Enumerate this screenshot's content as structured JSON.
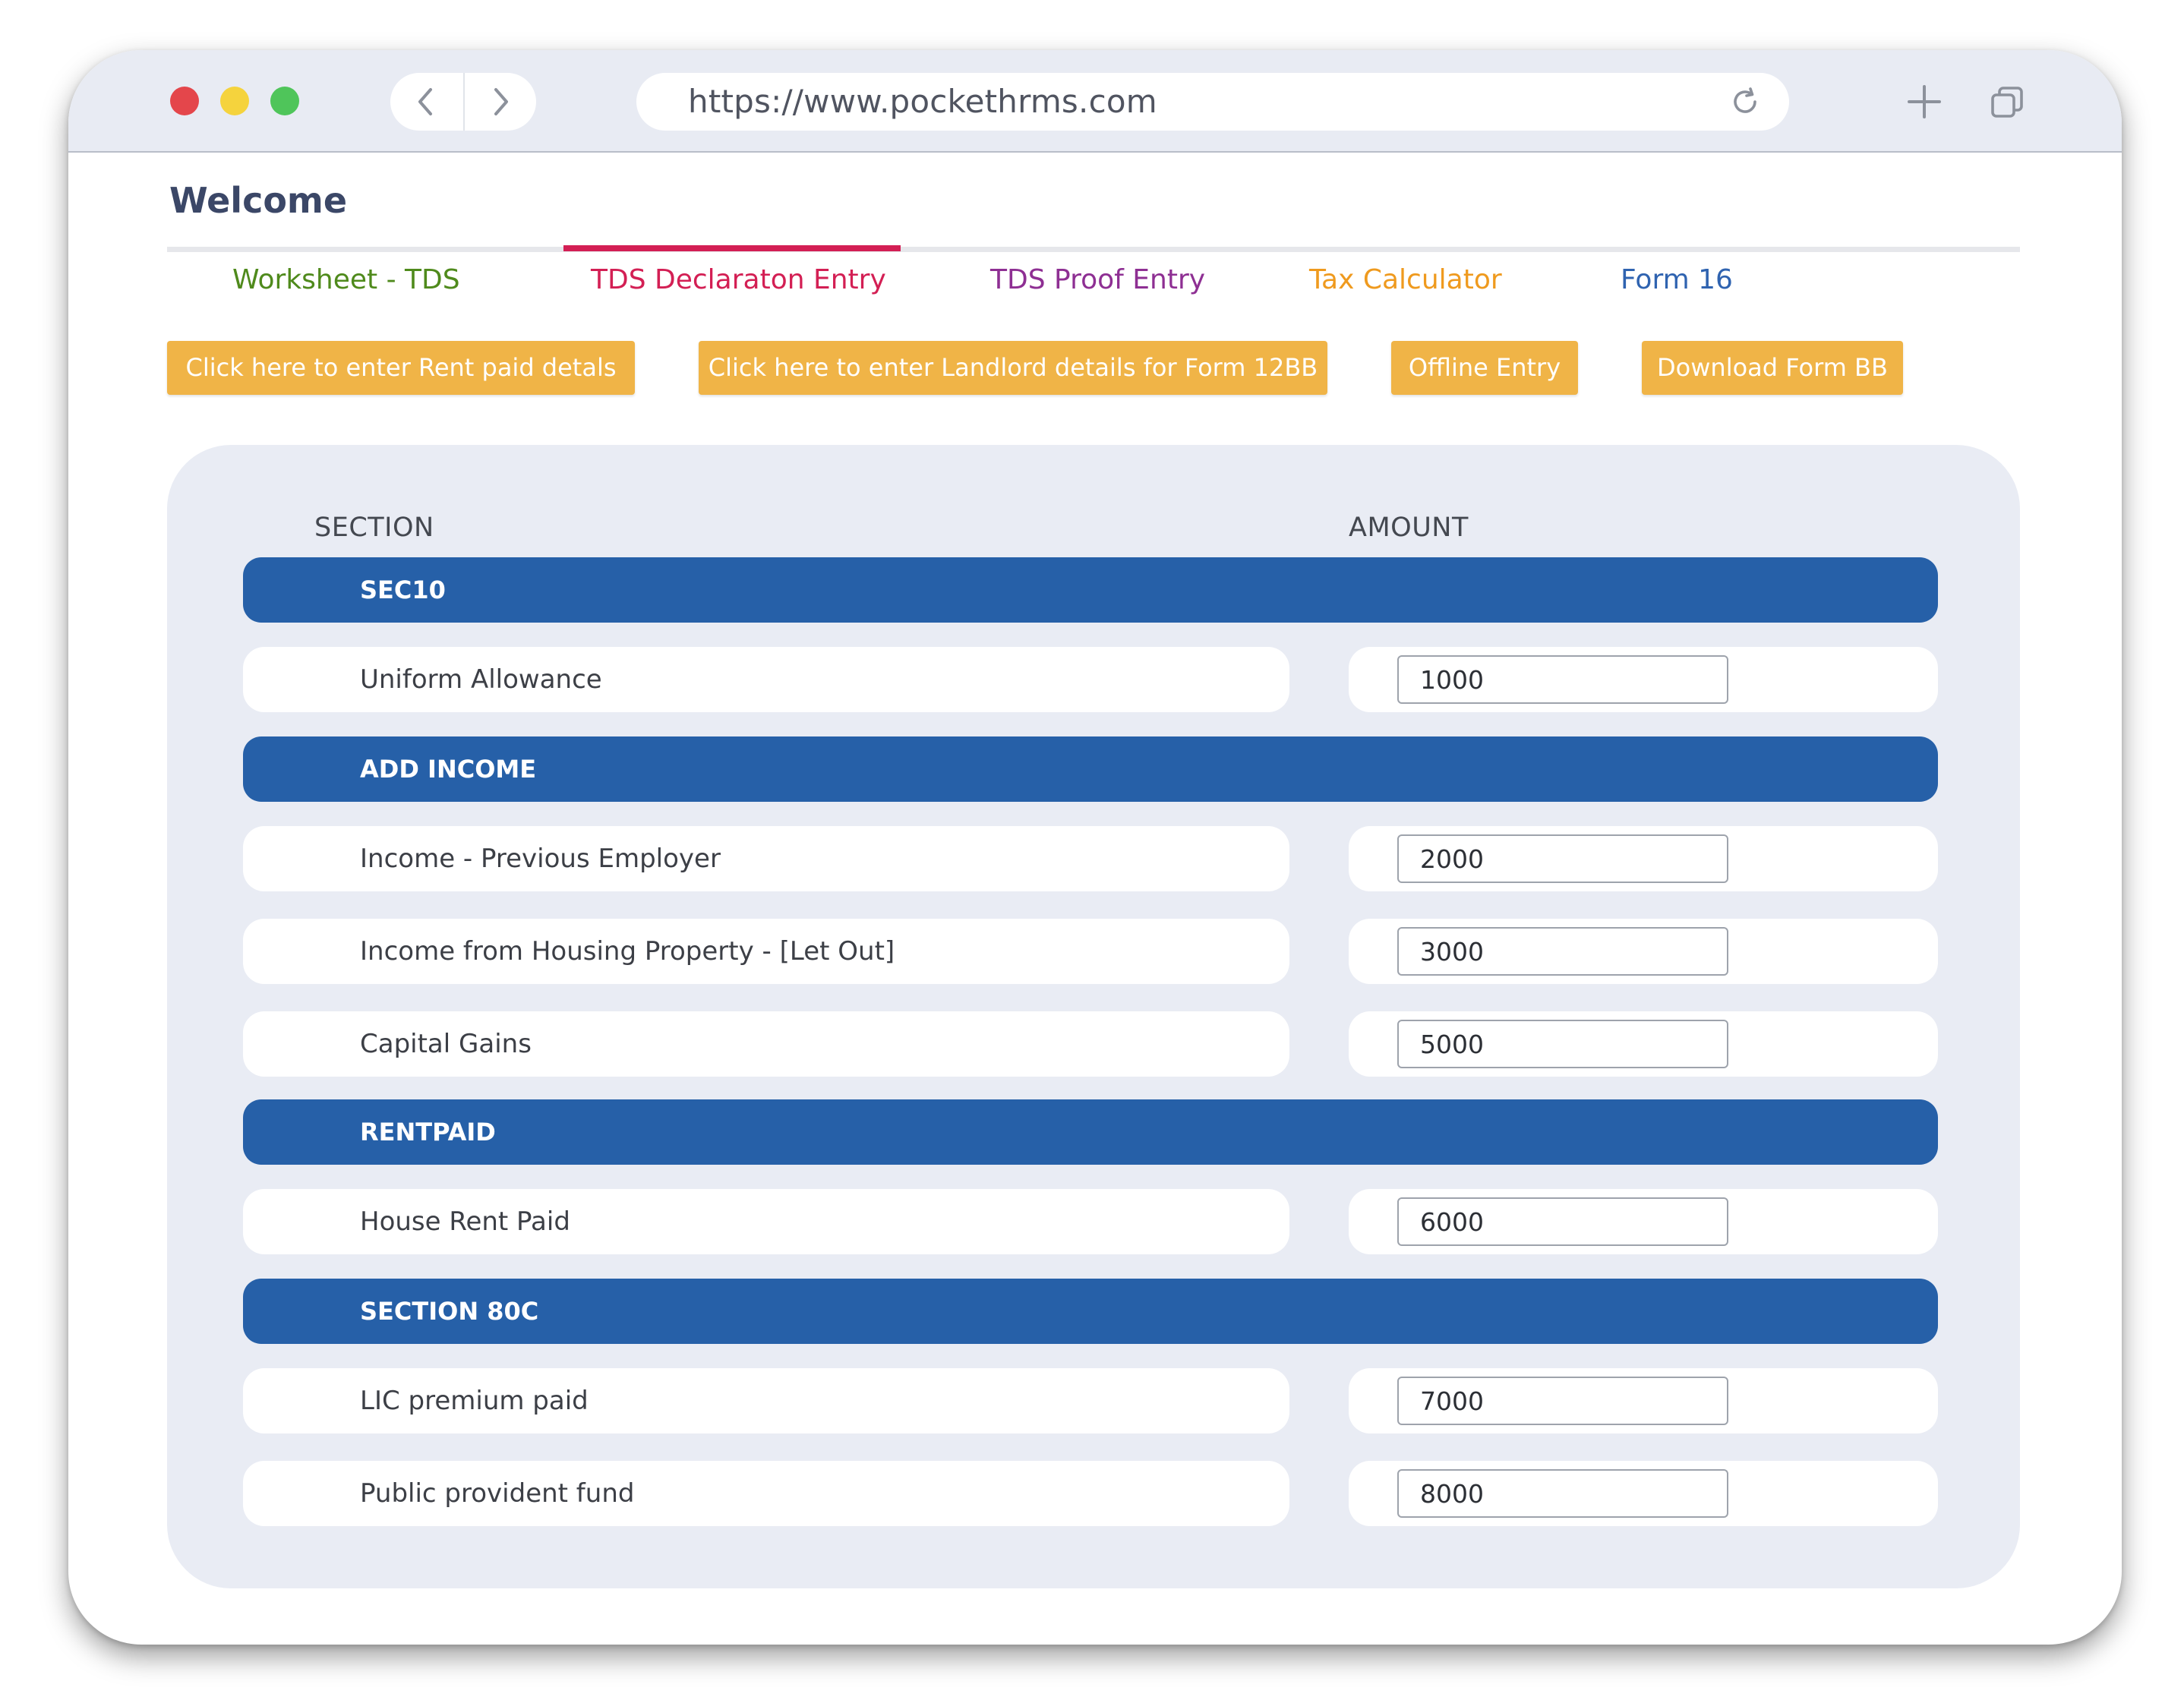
{
  "browser": {
    "url": "https://www.pockethrms.com",
    "traffic_lights": [
      "#e4464b",
      "#f5d33d",
      "#4fc55a"
    ],
    "back_icon": "chevron-left-icon",
    "forward_icon": "chevron-right-icon",
    "reload_icon": "reload-icon",
    "new_tab_icon": "plus-icon",
    "tabs_icon": "tabs-icon"
  },
  "page": {
    "title": "Welcome",
    "tabs": [
      {
        "label": "Worksheet - TDS",
        "color": "#4f8a1c",
        "active": false
      },
      {
        "label": "TDS Declaraton Entry",
        "color": "#d31f54",
        "active": true
      },
      {
        "label": "TDS Proof Entry",
        "color": "#8e2f93",
        "active": false
      },
      {
        "label": "Tax Calculator",
        "color": "#ef9a1e",
        "active": false
      },
      {
        "label": "Form 16",
        "color": "#2f63b0",
        "active": false
      }
    ],
    "actions": [
      "Click here to enter Rent paid detals",
      "Click here to enter Landlord details for Form 12BB",
      "Offline Entry",
      "Download Form BB"
    ],
    "accent_color": "#f0b447"
  },
  "table": {
    "headers": {
      "section": "SECTION",
      "amount": "AMOUNT"
    },
    "section_color": "#2660a8",
    "groups": [
      {
        "title": "SEC10",
        "rows": [
          {
            "label": "Uniform Allowance",
            "amount": "1000"
          }
        ]
      },
      {
        "title": "ADD INCOME",
        "rows": [
          {
            "label": "Income - Previous Employer",
            "amount": "2000"
          },
          {
            "label": "Income from Housing Property - [Let Out]",
            "amount": "3000"
          },
          {
            "label": "Capital Gains",
            "amount": "5000"
          }
        ]
      },
      {
        "title": "RENTPAID",
        "rows": [
          {
            "label": "House Rent Paid",
            "amount": "6000"
          }
        ]
      },
      {
        "title": "SECTION 80C",
        "rows": [
          {
            "label": "LIC premium paid",
            "amount": "7000"
          },
          {
            "label": "Public provident fund",
            "amount": "8000"
          }
        ]
      }
    ]
  }
}
